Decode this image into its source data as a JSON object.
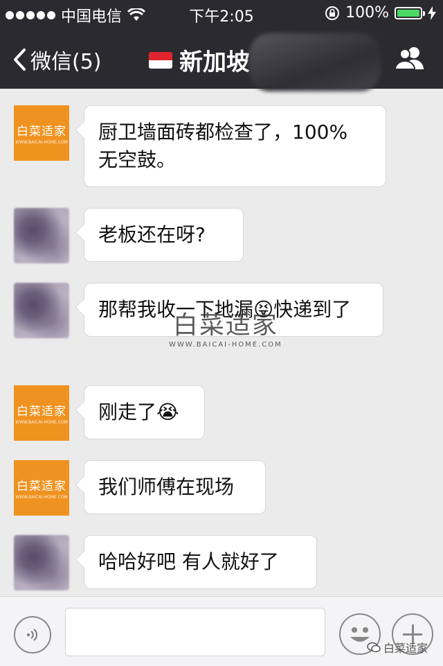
{
  "status_bar": {
    "carrier": "中国电信",
    "time": "下午2:05",
    "battery_text": "100%",
    "battery_level": 1.0
  },
  "nav": {
    "back_label": "微信(5)",
    "title": "新加坡",
    "flag_icon": "singapore-flag-icon",
    "contact_icon": "contacts-icon"
  },
  "messages": [
    {
      "sender": "brand",
      "text": "厨卫墙面砖都检查了，100% 无空鼓。"
    },
    {
      "sender": "other",
      "text": "老板还在呀?"
    },
    {
      "sender": "other",
      "text": "那帮我收一下地漏😝快递到了"
    },
    {
      "sender": "brand",
      "text": "刚走了😭"
    },
    {
      "sender": "brand",
      "text": "我们师傅在现场"
    },
    {
      "sender": "other",
      "text": "哈哈好吧 有人就好了"
    }
  ],
  "brand_avatar": {
    "name": "白菜适家",
    "url_text": "WWW.BAICAI-HOME.COM"
  },
  "watermark": {
    "name": "白菜适家",
    "url": "WWW.BAICAI-HOME.COM"
  },
  "input_bar": {
    "footer_mark": "白菜适家"
  },
  "colors": {
    "bar": "#2b2b2f",
    "brand_orange": "#f0921f",
    "battery_green": "#4cd964",
    "chat_bg": "#ebebeb"
  }
}
